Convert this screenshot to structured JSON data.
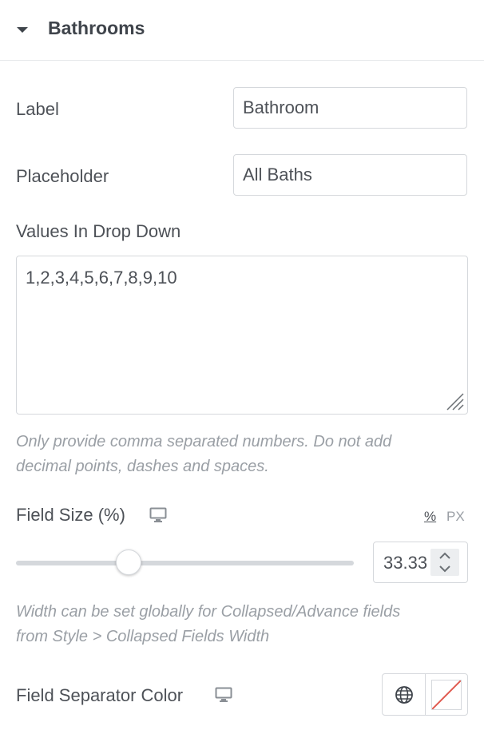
{
  "section": {
    "title": "Bathrooms"
  },
  "fields": {
    "label": {
      "label": "Label",
      "value": "Bathroom"
    },
    "placeholder": {
      "label": "Placeholder",
      "value": "All Baths"
    },
    "values_dropdown": {
      "label": "Values In Drop Down",
      "value": "1,2,3,4,5,6,7,8,9,10",
      "help_line1": "Only provide comma separated numbers. Do not add",
      "help_line2": "decimal points, dashes and spaces."
    },
    "field_size": {
      "label": "Field Size (%)",
      "unit_percent": "%",
      "unit_px": "PX",
      "value": "33.33",
      "slider_fraction": 0.3333,
      "help_line1": "Width can be set globally for Collapsed/Advance fields",
      "help_line2": "from Style > Collapsed Fields Width"
    },
    "separator_color": {
      "label": "Field Separator Color"
    }
  },
  "icons": {
    "collapse": "caret-down-icon",
    "responsive": "monitor-icon",
    "global": "globe-icon",
    "no_color": "no-color-swatch-icon"
  },
  "colors": {
    "text": "#4d5157",
    "help_text": "#9a9fa5",
    "border": "#d5d8dc",
    "swatch_slash": "#e05a4f"
  }
}
